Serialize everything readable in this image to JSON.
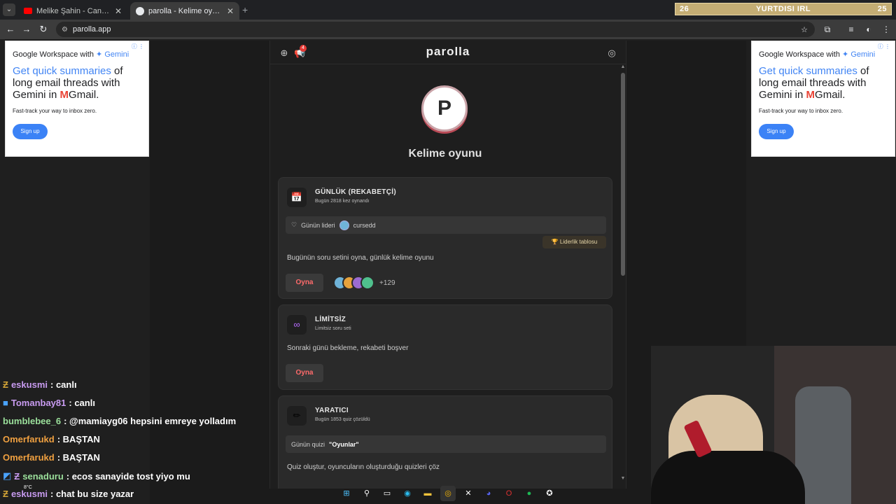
{
  "browser": {
    "tabs": [
      {
        "title": "Melike Şahin - Canın Beni Çekti",
        "active": false
      },
      {
        "title": "parolla - Kelime oyunu. Günlük",
        "active": true
      }
    ],
    "url": "parolla.app",
    "ticker": {
      "left": "26",
      "center": "YURTDISI IRL",
      "right": "25"
    }
  },
  "ads": {
    "brand_prefix": "Google Workspace with",
    "brand_suffix": "Gemini",
    "headline_blue": "Get quick summaries",
    "headline_rest_1": "of",
    "headline_rest_2": "long email threads with",
    "headline_rest_3": "Gemini in",
    "headline_rest_4": "Gmail.",
    "subline": "Fast-track your way to inbox zero.",
    "cta": "Sign up"
  },
  "app": {
    "logo": "parolla",
    "notification_count": "4",
    "avatar_letter": "P",
    "title": "Kelime oyunu",
    "cards": [
      {
        "title": "GÜNLÜK (REKABETÇİ)",
        "subtitle": "Bugün 2818 kez oynandı",
        "leader_label": "Günün lideri",
        "leader_name": "cursedd",
        "leaderboard_button": "Liderlik tablosu",
        "description": "Bugünün soru setini oyna, günlük kelime oyunu",
        "play": "Oyna",
        "more_players": "+129"
      },
      {
        "title": "LİMİTSİZ",
        "subtitle": "Limitsiz soru seti",
        "description": "Sonraki günü bekleme, rekabeti boşver",
        "play": "Oyna"
      },
      {
        "title": "YARATICI",
        "subtitle": "Bugün 1853 quiz çözüldü",
        "quiz_label": "Günün quizi",
        "quiz_name": "\"Oyunlar\"",
        "description": "Quiz oluştur, oyuncuların oluşturduğu quizleri çöz"
      }
    ]
  },
  "chat": [
    {
      "user": "eskusmi",
      "message": ": canlı",
      "color": "#c89bf0"
    },
    {
      "user": "Tomanbay81",
      "message": ": canlı",
      "color": "#c89bf0"
    },
    {
      "user": "bumblebee_6",
      "message": ": @mamiayg06 hepsini emreye yolladım",
      "color": "#9be09b"
    },
    {
      "user": "Omerfarukd",
      "message": ": BAŞTAN",
      "color": "#f0a040"
    },
    {
      "user": "Omerfarukd",
      "message": ": BAŞTAN",
      "color": "#f0a040"
    },
    {
      "user": "senaduru",
      "message": ": ecos sanayide tost yiyo mu",
      "color": "#9be09b"
    },
    {
      "user": "eskusmi",
      "message": ": chat bu size yazar",
      "color": "#c89bf0"
    }
  ],
  "weather": "8°C"
}
